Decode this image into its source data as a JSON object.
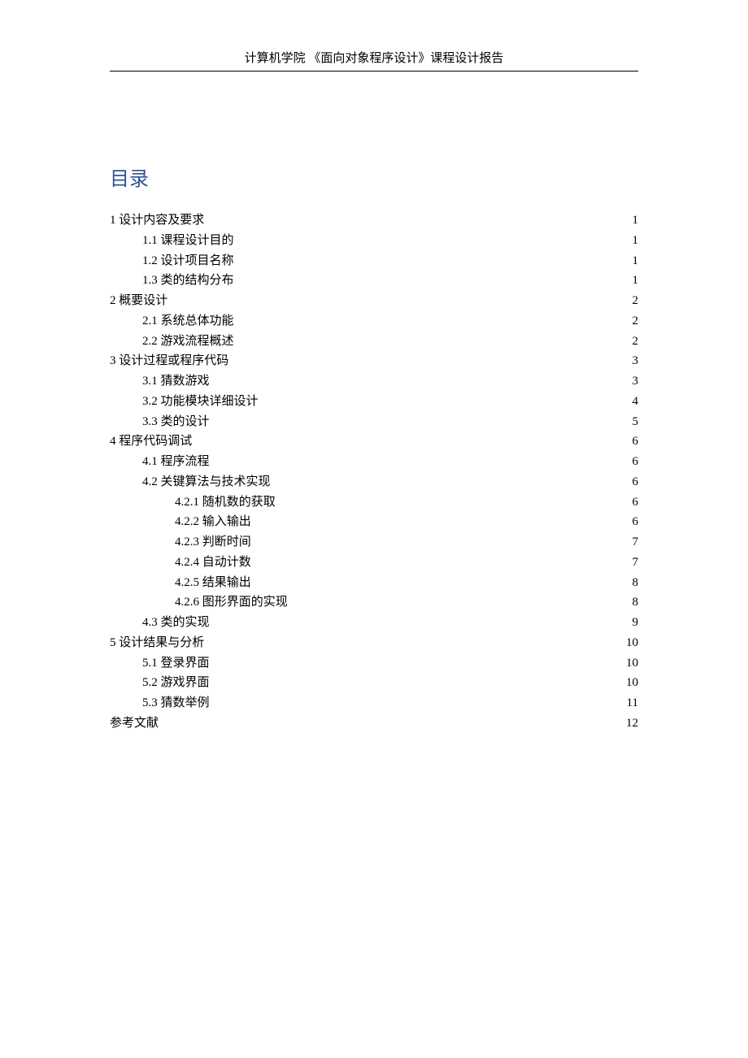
{
  "header": "计算机学院  《面向对象程序设计》课程设计报告",
  "toc_title": "目录",
  "entries": [
    {
      "indent": 0,
      "label": "1  设计内容及要求",
      "page": "1"
    },
    {
      "indent": 1,
      "label": "1.1    课程设计目的",
      "page": "1"
    },
    {
      "indent": 1,
      "label": "1.2    设计项目名称",
      "page": "1"
    },
    {
      "indent": 1,
      "label": "1.3    类的结构分布",
      "page": "1"
    },
    {
      "indent": 0,
      "label": "2  概要设计",
      "page": "2"
    },
    {
      "indent": 1,
      "label": "2.1 系统总体功能",
      "page": "2"
    },
    {
      "indent": 1,
      "label": "2.2  游戏流程概述",
      "page": "2"
    },
    {
      "indent": 0,
      "label": "3  设计过程或程序代码",
      "page": "3"
    },
    {
      "indent": 1,
      "label": "3.1 猜数游戏",
      "page": "3"
    },
    {
      "indent": 1,
      "label": "3.2 功能模块详细设计",
      "page": "4"
    },
    {
      "indent": 1,
      "label": "3.3  类的设计",
      "page": "5"
    },
    {
      "indent": 0,
      "label": "4  程序代码调试",
      "page": "6"
    },
    {
      "indent": 1,
      "label": "4.1 程序流程",
      "page": "6"
    },
    {
      "indent": 1,
      "label": "4.2 关键算法与技术实现",
      "page": "6"
    },
    {
      "indent": 2,
      "label": "4.2.1  随机数的获取",
      "page": "6"
    },
    {
      "indent": 2,
      "label": "4.2.2  输入输出",
      "page": "6"
    },
    {
      "indent": 2,
      "label": "4.2.3  判断时间",
      "page": "7"
    },
    {
      "indent": 2,
      "label": "4.2.4  自动计数",
      "page": "7"
    },
    {
      "indent": 2,
      "label": "4.2.5  结果输出",
      "page": "8"
    },
    {
      "indent": 2,
      "label": "4.2.6  图形界面的实现",
      "page": "8"
    },
    {
      "indent": 1,
      "label": "4.3  类的实现",
      "page": "9"
    },
    {
      "indent": 0,
      "label": "5 设计结果与分析",
      "page": "10"
    },
    {
      "indent": 1,
      "label": "5.1 登录界面",
      "page": "10"
    },
    {
      "indent": 1,
      "label": "5.2 游戏界面",
      "page": "10"
    },
    {
      "indent": 1,
      "label": "5.3 猜数举例",
      "page": "11"
    },
    {
      "indent": 0,
      "label": "参考文献",
      "page": "12"
    }
  ]
}
